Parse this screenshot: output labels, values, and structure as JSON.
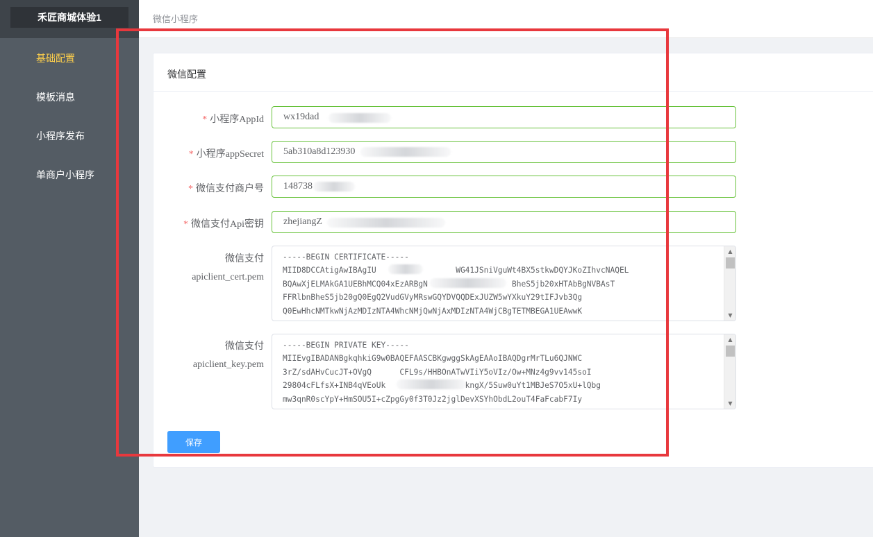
{
  "sidebar": {
    "brand": "禾匠商城体验1",
    "items": [
      {
        "label": "基础配置",
        "active": true
      },
      {
        "label": "模板消息",
        "active": false
      },
      {
        "label": "小程序发布",
        "active": false
      },
      {
        "label": "单商户小程序",
        "active": false
      }
    ]
  },
  "header": {
    "breadcrumb": "微信小程序"
  },
  "card": {
    "title": "微信配置"
  },
  "form": {
    "appid": {
      "label": "小程序AppId",
      "value": "wx19dad"
    },
    "app_secret": {
      "label": "小程序appSecret",
      "value": "5ab310a8d123930"
    },
    "mch_id": {
      "label": "微信支付商户号",
      "value": "148738"
    },
    "api_key": {
      "label": "微信支付Api密钥",
      "value": "zhejiangZ"
    },
    "cert_pem": {
      "label_line1": "微信支付",
      "label_line2": "apiclient_cert.pem",
      "value": "-----BEGIN CERTIFICATE-----\nMIID8DCCAtigAwIBAgIU                 WG41JSniVguWt4BX5stkwDQYJKoZIhvcNAQEL\nBQAwXjELMAkGA1UEBhMCQ04xEzARBgN                  BheS5jb20xHTAbBgNVBAsT\nFFRlbnBheS5jb20gQ0EgQ2VudGVyMRswGQYDVQQDExJUZW5wYXkuY29tIFJvb3Qg\nQ0EwHhcNMTkwNjAzMDIzNTA4WhcNMjQwNjAxMDIzNTA4WjCBgTETMBEGA1UEAwwK"
    },
    "key_pem": {
      "label_line1": "微信支付",
      "label_line2": "apiclient_key.pem",
      "value": "-----BEGIN PRIVATE KEY-----\nMIIEvgIBADANBgkqhkiG9w0BAQEFAASCBKgwggSkAgEAAoIBAQDgrMrTLu6QJNWC\n3rZ/sdAHvCucJT+OVgQ      CFL9s/HHBOnATwVIiY5oVIz/Ow+MNz4g9vv145soI\n29804cFLfsX+INB4qVEoUk                 kngX/5Suw0uYt1MBJeS7O5xU+lQbg\nmw3qnR0scYpY+HmSOU5I+cZpgGy0f3T0Jz2jglDevXSYhObdL2ouT4FaFcabF7Iy"
    },
    "save_label": "保存"
  },
  "colors": {
    "sidebar_bg": "#545c64",
    "active_menu": "#ffd04b",
    "primary": "#409eff",
    "valid_border": "#67c23a",
    "highlight": "#e8383d"
  }
}
